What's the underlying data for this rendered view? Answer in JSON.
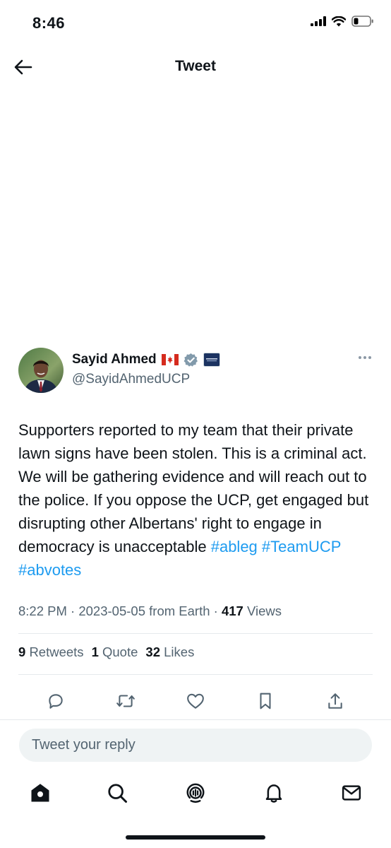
{
  "status_bar": {
    "time": "8:46"
  },
  "nav": {
    "title": "Tweet"
  },
  "tweet": {
    "author_name": "Sayid Ahmed",
    "author_handle": "@SayidAhmedUCP",
    "text": "Supporters reported to my team that their private lawn signs have been stolen. This is a criminal act. We will be gathering evidence and will reach out to the police. If you oppose the UCP, get engaged but disrupting other Albertans' right to engage in democracy is unacceptable",
    "hashtags": [
      "#ableg",
      "#TeamUCP",
      "#abvotes"
    ],
    "time": "8:22 PM",
    "date": "2023-05-05",
    "source": "from Earth",
    "views_count": "417",
    "views_label": "Views",
    "retweets_count": "9",
    "retweets_label": "Retweets",
    "quotes_count": "1",
    "quotes_label": "Quote",
    "likes_count": "32",
    "likes_label": "Likes"
  },
  "actions": [
    "reply-icon",
    "retweet-icon",
    "like-icon",
    "bookmark-icon",
    "share-icon"
  ],
  "reply": {
    "placeholder": "Tweet your reply"
  },
  "tab_bar": [
    "home-icon",
    "search-icon",
    "spaces-icon",
    "notifications-icon",
    "messages-icon"
  ],
  "colors": {
    "link": "#1d9bf0",
    "secondary_text": "#536471",
    "verified": "#829aab"
  }
}
